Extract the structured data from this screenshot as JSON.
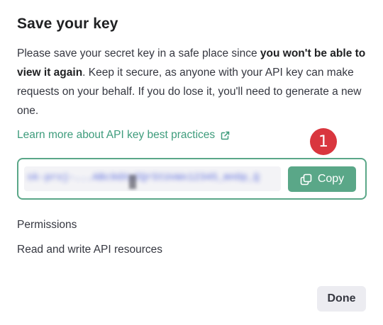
{
  "dialog": {
    "title": "Save your key",
    "description": {
      "part1": "Please save your secret key in a safe place since ",
      "bold": "you won't be able to view it again",
      "part2": ". Keep it secure, as anyone with your API key can make requests on your behalf. If you do lose it, you'll need to generate a new one."
    },
    "learn_more_label": "Learn more about API key best practices",
    "learn_more_icon": "external-link-icon",
    "annotation_badge": "1",
    "key": {
      "value": "sk-proj-...ABc9dXyZQrStUvWx12345_mnOp_Q",
      "copy_label": "Copy",
      "copy_icon": "copy-icon"
    },
    "permissions": {
      "label": "Permissions",
      "value": "Read and write API resources"
    },
    "done_label": "Done"
  },
  "colors": {
    "accent": "#5aa788",
    "badge": "#d9363e",
    "text": "#353740",
    "done_bg": "#ececf1"
  }
}
